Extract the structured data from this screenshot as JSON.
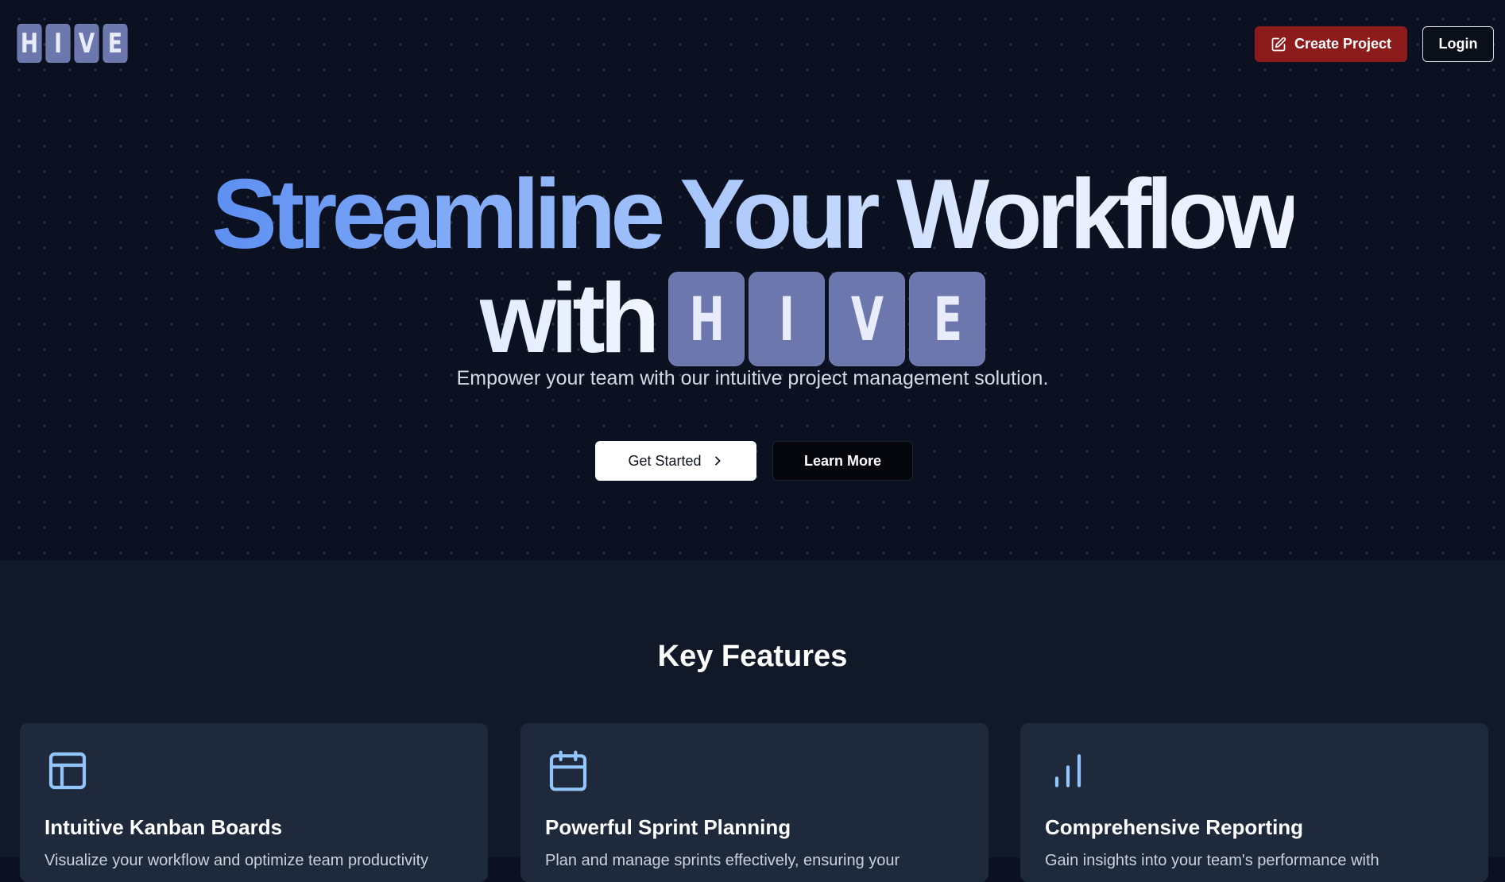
{
  "brand": {
    "letters": [
      "H",
      "I",
      "V",
      "E"
    ]
  },
  "nav": {
    "create_label": "Create Project",
    "login_label": "Login"
  },
  "hero": {
    "headline_line1": "Streamline Your Workflow",
    "headline_with": "with",
    "headline_letters": [
      "H",
      "I",
      "V",
      "E"
    ],
    "subtitle": "Empower your team with our intuitive project management solution.",
    "primary_cta": "Get Started",
    "secondary_cta": "Learn More"
  },
  "features": {
    "title": "Key Features",
    "items": [
      {
        "icon": "kanban-layout-icon",
        "title": "Intuitive Kanban Boards",
        "description": "Visualize your workflow and optimize team productivity"
      },
      {
        "icon": "calendar-icon",
        "title": "Powerful Sprint Planning",
        "description": "Plan and manage sprints effectively, ensuring your"
      },
      {
        "icon": "bar-chart-icon",
        "title": "Comprehensive Reporting",
        "description": "Gain insights into your team's performance with"
      }
    ]
  },
  "colors": {
    "background": "#0b1120",
    "tile": "#6b77ad",
    "create_button": "#8c1c1c",
    "card": "#1e293b",
    "icon_accent": "#93c5fd"
  }
}
